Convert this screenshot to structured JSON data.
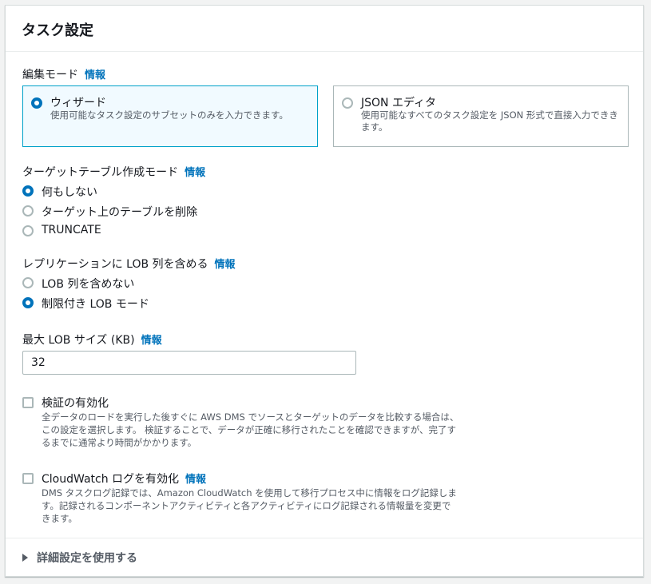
{
  "panel": {
    "title": "タスク設定"
  },
  "edit_mode": {
    "label": "編集モード",
    "info": "情報",
    "options": [
      {
        "title": "ウィザード",
        "description": "使用可能なタスク設定のサブセットのみを入力できます。",
        "selected": true
      },
      {
        "title": "JSON エディタ",
        "description_lines": [
          "使用可能なすべてのタスク設定を JSON 形式で直接入力できき",
          "ます。"
        ],
        "selected": false
      }
    ]
  },
  "target_table_mode": {
    "label": "ターゲットテーブル作成モード",
    "info": "情報",
    "options": [
      {
        "label": "何もしない",
        "selected": true
      },
      {
        "label": "ターゲット上のテーブルを削除",
        "selected": false
      },
      {
        "label": "TRUNCATE",
        "selected": false
      }
    ]
  },
  "lob_mode": {
    "label": "レプリケーションに LOB 列を含める",
    "info": "情報",
    "options": [
      {
        "label": "LOB 列を含めない",
        "selected": false
      },
      {
        "label": "制限付き LOB モード",
        "selected": true
      }
    ]
  },
  "max_lob": {
    "label": "最大 LOB サイズ (KB)",
    "info": "情報",
    "value": "32"
  },
  "validation": {
    "label": "検証の有効化",
    "checked": false,
    "description_lines": [
      "全データのロードを実行した後すぐに AWS DMS でソースとターゲットのデータを比較する場合は、",
      "この設定を選択します。 検証することで、データが正確に移行されたことを確認できますが、完了す",
      "るまでに通常より時間がかかります。"
    ]
  },
  "cloudwatch": {
    "label": "CloudWatch ログを有効化",
    "info": "情報",
    "checked": false,
    "description_lines": [
      "DMS タスクログ記録では、Amazon CloudWatch を使用して移行プロセス中に情報をログ記録しま",
      "す。記録されるコンポーネントアクティビティと各アクティビティにログ記録される情報量を変更で",
      "きます。"
    ]
  },
  "advanced": {
    "label": "詳細設定を使用する"
  },
  "colors": {
    "accent": "#0073bb",
    "tile_selected_bg": "#f1faff",
    "tile_selected_border": "#00a1c9"
  }
}
